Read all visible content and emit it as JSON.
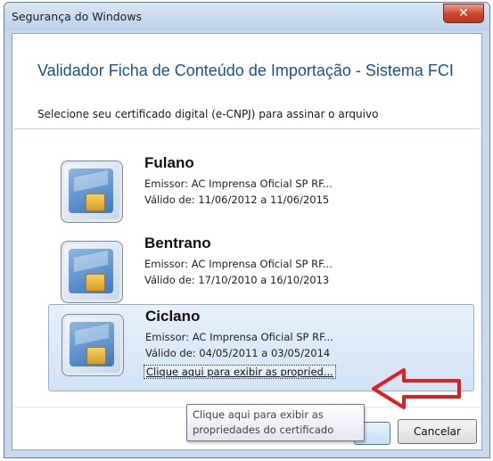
{
  "window": {
    "title": "Segurança do Windows",
    "close_icon": "close-icon"
  },
  "dialog": {
    "heading": "Validador Ficha de Conteúdo de Importação - Sistema FCI",
    "instruction": "Selecione seu certificado digital (e-CNPJ) para assinar o arquivo"
  },
  "certificates": [
    {
      "name": "Fulano",
      "issuer": "Emissor: AC Imprensa Oficial SP RF...",
      "validity": "Válido de: 11/06/2012 a 11/06/2015",
      "selected": false,
      "icon": "smart-card-icon"
    },
    {
      "name": "Bentrano",
      "issuer": "Emissor: AC Imprensa Oficial SP RF...",
      "validity": "Válido de: 17/10/2010 a 16/10/2013",
      "selected": false,
      "icon": "smart-card-icon"
    },
    {
      "name": "Ciclano",
      "issuer": "Emissor: AC Imprensa Oficial SP RF...",
      "validity": "Válido de: 04/05/2011 a 03/05/2014",
      "selected": true,
      "icon": "smart-card-icon",
      "properties_link": "Clique aqui para exibir as propried..."
    }
  ],
  "tooltip": {
    "line1": "Clique aqui para exibir as",
    "line2": "propriedades do certificado"
  },
  "buttons": {
    "cancel": "Cancelar"
  },
  "annotation": {
    "arrow_color": "#e02020",
    "icon": "red-arrow-icon"
  },
  "colors": {
    "heading": "#1c4f9a",
    "selection": "#d3e3f5",
    "close_button": "#c8452d"
  }
}
